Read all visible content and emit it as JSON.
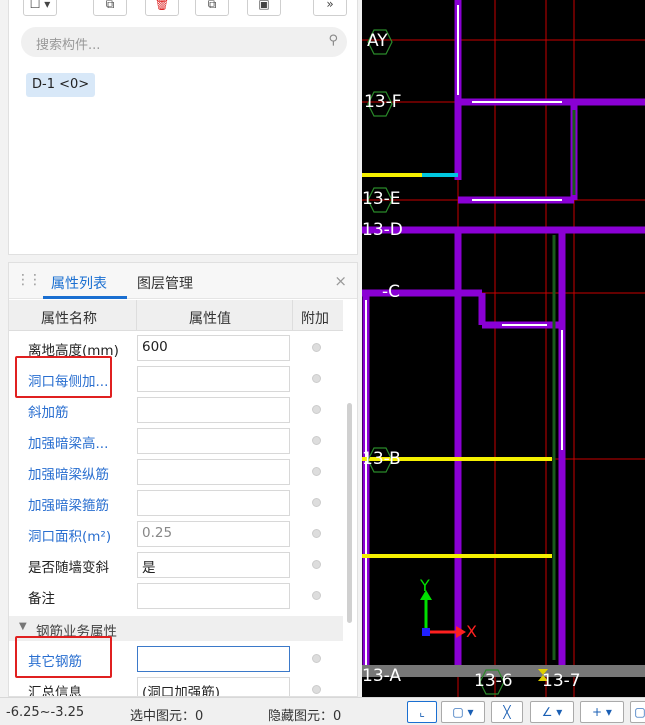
{
  "component_panel": {
    "search_placeholder": "搜索构件...",
    "chip": "D-1 <0>",
    "more": "»"
  },
  "property_panel": {
    "tabs": [
      "属性列表",
      "图层管理"
    ],
    "close": "×",
    "headers": {
      "name": "属性名称",
      "value": "属性值",
      "extra": "附加"
    },
    "rows": [
      {
        "name": "离地高度(mm)",
        "value": "600",
        "name_color": "black"
      },
      {
        "name": "洞口每侧加...",
        "value": "",
        "name_color": "blue",
        "highlighted": true
      },
      {
        "name": "斜加筋",
        "value": "",
        "name_color": "blue"
      },
      {
        "name": "加强暗梁高...",
        "value": "",
        "name_color": "blue"
      },
      {
        "name": "加强暗梁纵筋",
        "value": "",
        "name_color": "blue"
      },
      {
        "name": "加强暗梁箍筋",
        "value": "",
        "name_color": "blue"
      },
      {
        "name": "洞口面积(m²)",
        "value": "0.25",
        "name_color": "blue"
      },
      {
        "name": "是否随墙变斜",
        "value": "是",
        "name_color": "black"
      },
      {
        "name": "备注",
        "value": "",
        "name_color": "black"
      }
    ],
    "group": {
      "label": "钢筋业务属性",
      "icon": "triangle-down-icon"
    },
    "rows2": [
      {
        "name": "其它钢筋",
        "value": "",
        "name_color": "blue",
        "highlighted": true,
        "button": "⋯"
      },
      {
        "name": "汇总信息",
        "value": "(洞口加强筋)",
        "name_color": "black"
      }
    ]
  },
  "canvas": {
    "axis_labels": [
      "AY",
      "13-F",
      "13-E",
      "13-D",
      "-C",
      "13-B",
      "13-A",
      "13-6",
      "13-7"
    ],
    "coord_x": "X",
    "coord_y": "Y",
    "colors": {
      "background": "#000000",
      "wall": "#8a00d4",
      "beam_yellow": "#f5f000",
      "cyan": "#00c8e0",
      "grid_red": "#c80000"
    }
  },
  "status": {
    "range": "-6.25~-3.25",
    "selected": "选中图元：0",
    "hidden": "隐藏图元：0"
  }
}
